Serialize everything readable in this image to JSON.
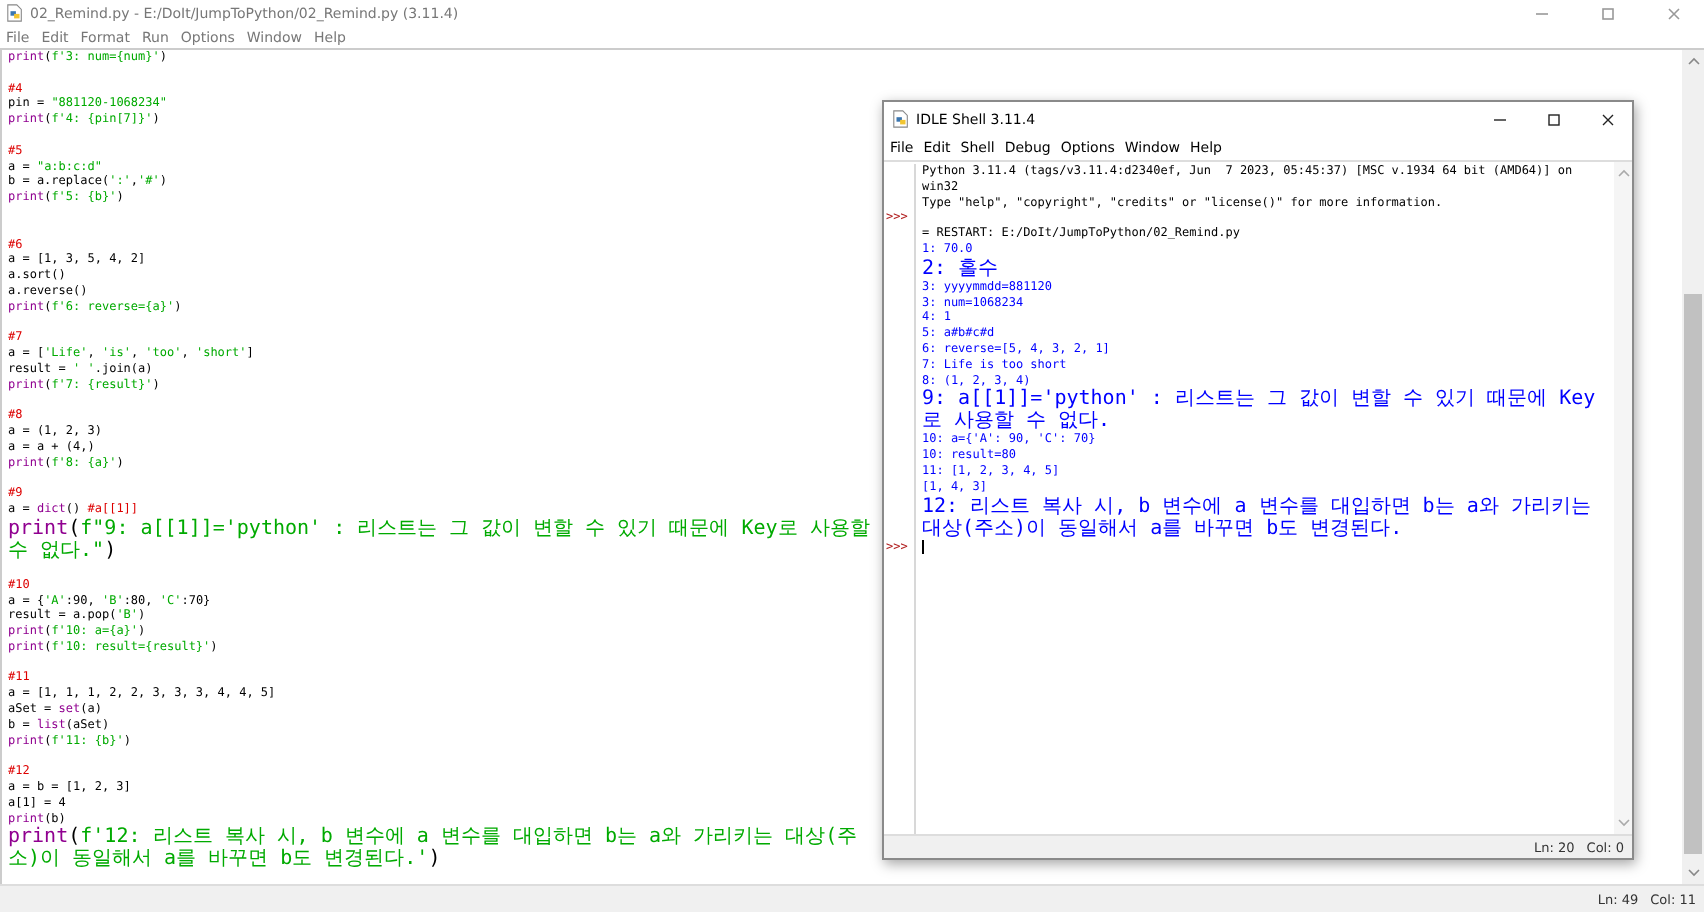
{
  "editor": {
    "title": "02_Remind.py - E:/DoIt/JumpToPython/02_Remind.py (3.11.4)",
    "menu": [
      "File",
      "Edit",
      "Format",
      "Run",
      "Options",
      "Window",
      "Help"
    ],
    "blocks": [
      {
        "extra_gap": false,
        "lines": [
          [
            {
              "kind": "builtin",
              "text": "print"
            },
            {
              "kind": "plain",
              "text": "("
            },
            {
              "kind": "string",
              "text": "f'3: num={num}'"
            },
            {
              "kind": "plain",
              "text": ")"
            }
          ]
        ]
      },
      {
        "extra_gap": false,
        "lines": [
          [
            {
              "kind": "comment",
              "text": "#4"
            }
          ],
          [
            {
              "kind": "plain",
              "text": "pin = "
            },
            {
              "kind": "string",
              "text": "\"881120-1068234\""
            }
          ],
          [
            {
              "kind": "builtin",
              "text": "print"
            },
            {
              "kind": "plain",
              "text": "("
            },
            {
              "kind": "string",
              "text": "f'4: {pin[7]}'"
            },
            {
              "kind": "plain",
              "text": ")"
            }
          ]
        ]
      },
      {
        "extra_gap": false,
        "lines": [
          [
            {
              "kind": "comment",
              "text": "#5"
            }
          ],
          [
            {
              "kind": "plain",
              "text": "a = "
            },
            {
              "kind": "string",
              "text": "\"a:b:c:d\""
            }
          ],
          [
            {
              "kind": "plain",
              "text": "b = a.replace("
            },
            {
              "kind": "string",
              "text": "':'"
            },
            {
              "kind": "plain",
              "text": ","
            },
            {
              "kind": "string",
              "text": "'#'"
            },
            {
              "kind": "plain",
              "text": ")"
            }
          ],
          [
            {
              "kind": "builtin",
              "text": "print"
            },
            {
              "kind": "plain",
              "text": "("
            },
            {
              "kind": "string",
              "text": "f'5: {b}'"
            },
            {
              "kind": "plain",
              "text": ")"
            }
          ]
        ]
      },
      {
        "extra_gap": true,
        "lines": [
          [
            {
              "kind": "comment",
              "text": "#6"
            }
          ],
          [
            {
              "kind": "plain",
              "text": "a = [1, 3, 5, 4, 2]"
            }
          ],
          [
            {
              "kind": "plain",
              "text": "a.sort()"
            }
          ],
          [
            {
              "kind": "plain",
              "text": "a.reverse()"
            }
          ],
          [
            {
              "kind": "builtin",
              "text": "print"
            },
            {
              "kind": "plain",
              "text": "("
            },
            {
              "kind": "string",
              "text": "f'6: reverse={a}'"
            },
            {
              "kind": "plain",
              "text": ")"
            }
          ]
        ]
      },
      {
        "extra_gap": false,
        "lines": [
          [
            {
              "kind": "comment",
              "text": "#7"
            }
          ],
          [
            {
              "kind": "plain",
              "text": "a = ["
            },
            {
              "kind": "string",
              "text": "'Life'"
            },
            {
              "kind": "plain",
              "text": ", "
            },
            {
              "kind": "string",
              "text": "'is'"
            },
            {
              "kind": "plain",
              "text": ", "
            },
            {
              "kind": "string",
              "text": "'too'"
            },
            {
              "kind": "plain",
              "text": ", "
            },
            {
              "kind": "string",
              "text": "'short'"
            },
            {
              "kind": "plain",
              "text": "]"
            }
          ],
          [
            {
              "kind": "plain",
              "text": "result = "
            },
            {
              "kind": "string",
              "text": "' '"
            },
            {
              "kind": "plain",
              "text": ".join(a)"
            }
          ],
          [
            {
              "kind": "builtin",
              "text": "print"
            },
            {
              "kind": "plain",
              "text": "("
            },
            {
              "kind": "string",
              "text": "f'7: {result}'"
            },
            {
              "kind": "plain",
              "text": ")"
            }
          ]
        ]
      },
      {
        "extra_gap": false,
        "lines": [
          [
            {
              "kind": "comment",
              "text": "#8"
            }
          ],
          [
            {
              "kind": "plain",
              "text": "a = (1, 2, 3)"
            }
          ],
          [
            {
              "kind": "plain",
              "text": "a = a + (4,)"
            }
          ],
          [
            {
              "kind": "builtin",
              "text": "print"
            },
            {
              "kind": "plain",
              "text": "("
            },
            {
              "kind": "string",
              "text": "f'8: {a}'"
            },
            {
              "kind": "plain",
              "text": ")"
            }
          ]
        ]
      },
      {
        "extra_gap": false,
        "lines": [
          [
            {
              "kind": "comment",
              "text": "#9"
            }
          ],
          [
            {
              "kind": "plain",
              "text": "a = "
            },
            {
              "kind": "builtin",
              "text": "dict"
            },
            {
              "kind": "plain",
              "text": "() "
            },
            {
              "kind": "comment",
              "text": "#a[[1]]"
            }
          ],
          [
            {
              "kind": "builtin",
              "text": "print"
            },
            {
              "kind": "plain",
              "text": "("
            },
            {
              "kind": "string",
              "text": "f\"9: a[[1]]='python' : 리스트는 그 값이 변할 수 있기 때문에 Key로 사용할 수 없다.\""
            },
            {
              "kind": "plain",
              "text": ")"
            }
          ]
        ]
      },
      {
        "extra_gap": false,
        "lines": [
          [
            {
              "kind": "comment",
              "text": "#10"
            }
          ],
          [
            {
              "kind": "plain",
              "text": "a = {"
            },
            {
              "kind": "string",
              "text": "'A'"
            },
            {
              "kind": "plain",
              "text": ":90, "
            },
            {
              "kind": "string",
              "text": "'B'"
            },
            {
              "kind": "plain",
              "text": ":80, "
            },
            {
              "kind": "string",
              "text": "'C'"
            },
            {
              "kind": "plain",
              "text": ":70}"
            }
          ],
          [
            {
              "kind": "plain",
              "text": "result = a.pop("
            },
            {
              "kind": "string",
              "text": "'B'"
            },
            {
              "kind": "plain",
              "text": ")"
            }
          ],
          [
            {
              "kind": "builtin",
              "text": "print"
            },
            {
              "kind": "plain",
              "text": "("
            },
            {
              "kind": "string",
              "text": "f'10: a={a}'"
            },
            {
              "kind": "plain",
              "text": ")"
            }
          ],
          [
            {
              "kind": "builtin",
              "text": "print"
            },
            {
              "kind": "plain",
              "text": "("
            },
            {
              "kind": "string",
              "text": "f'10: result={result}'"
            },
            {
              "kind": "plain",
              "text": ")"
            }
          ]
        ]
      },
      {
        "extra_gap": false,
        "lines": [
          [
            {
              "kind": "comment",
              "text": "#11"
            }
          ],
          [
            {
              "kind": "plain",
              "text": "a = [1, 1, 1, 2, 2, 3, 3, 3, 4, 4, 5]"
            }
          ],
          [
            {
              "kind": "plain",
              "text": "aSet = "
            },
            {
              "kind": "builtin",
              "text": "set"
            },
            {
              "kind": "plain",
              "text": "(a)"
            }
          ],
          [
            {
              "kind": "plain",
              "text": "b = "
            },
            {
              "kind": "builtin",
              "text": "list"
            },
            {
              "kind": "plain",
              "text": "(aSet)"
            }
          ],
          [
            {
              "kind": "builtin",
              "text": "print"
            },
            {
              "kind": "plain",
              "text": "("
            },
            {
              "kind": "string",
              "text": "f'11: {b}'"
            },
            {
              "kind": "plain",
              "text": ")"
            }
          ]
        ]
      },
      {
        "extra_gap": false,
        "lines": [
          [
            {
              "kind": "comment",
              "text": "#12"
            }
          ],
          [
            {
              "kind": "plain",
              "text": "a = b = [1, 2, 3]"
            }
          ],
          [
            {
              "kind": "plain",
              "text": "a[1] = 4"
            }
          ],
          [
            {
              "kind": "builtin",
              "text": "print"
            },
            {
              "kind": "plain",
              "text": "(b)"
            }
          ],
          [
            {
              "kind": "builtin",
              "text": "print"
            },
            {
              "kind": "plain",
              "text": "("
            },
            {
              "kind": "string",
              "text": "f'12: 리스트 복사 시, b 변수에 a 변수를 대입하면 b는 a와 가리키는 대상(주소)이 동일해서 a를 바꾸면 b도 변경된다.'"
            },
            {
              "kind": "plain",
              "text": ")"
            }
          ]
        ]
      }
    ],
    "status": {
      "line": "Ln: 49",
      "column": "Col: 11"
    }
  },
  "shell": {
    "title": "IDLE Shell 3.11.4",
    "menu": [
      "File",
      "Edit",
      "Shell",
      "Debug",
      "Options",
      "Window",
      "Help"
    ],
    "lines": [
      {
        "kind": "info",
        "text": "Python 3.11.4 (tags/v3.11.4:d2340ef, Jun  7 2023, 05:45:37) [MSC v.1934 64 bit (AMD64)] on win32"
      },
      {
        "kind": "info",
        "text": "Type \"help\", \"copyright\", \"credits\" or \"license()\" for more information."
      },
      {
        "kind": "prompt",
        "text": ">>>"
      },
      {
        "kind": "info",
        "text": "= RESTART: E:/DoIt/JumpToPython/02_Remind.py"
      },
      {
        "kind": "stdout",
        "text": "1: 70.0"
      },
      {
        "kind": "stdout",
        "text": "2: 홀수"
      },
      {
        "kind": "stdout",
        "text": "3: yyyymmdd=881120"
      },
      {
        "kind": "stdout",
        "text": "3: num=1068234"
      },
      {
        "kind": "stdout",
        "text": "4: 1"
      },
      {
        "kind": "stdout",
        "text": "5: a#b#c#d"
      },
      {
        "kind": "stdout",
        "text": "6: reverse=[5, 4, 3, 2, 1]"
      },
      {
        "kind": "stdout",
        "text": "7: Life is too short"
      },
      {
        "kind": "stdout",
        "text": "8: (1, 2, 3, 4)"
      },
      {
        "kind": "stdout",
        "text": "9: a[[1]]='python' : 리스트는 그 값이 변할 수 있기 때문에 Key로 사용할 수 없다."
      },
      {
        "kind": "stdout",
        "text": "10: a={'A': 90, 'C': 70}"
      },
      {
        "kind": "stdout",
        "text": "10: result=80"
      },
      {
        "kind": "stdout",
        "text": "11: [1, 2, 3, 4, 5]"
      },
      {
        "kind": "stdout",
        "text": "[1, 4, 3]"
      },
      {
        "kind": "stdout",
        "text": "12: 리스트 복사 시, b 변수에 a 변수를 대입하면 b는 a와 가리키는 대상(주소)이 동일해서 a를 바꾸면 b도 변경된다."
      },
      {
        "kind": "input",
        "text": ">>>"
      }
    ],
    "status": {
      "line": "Ln: 20",
      "column": "Col: 0"
    }
  }
}
